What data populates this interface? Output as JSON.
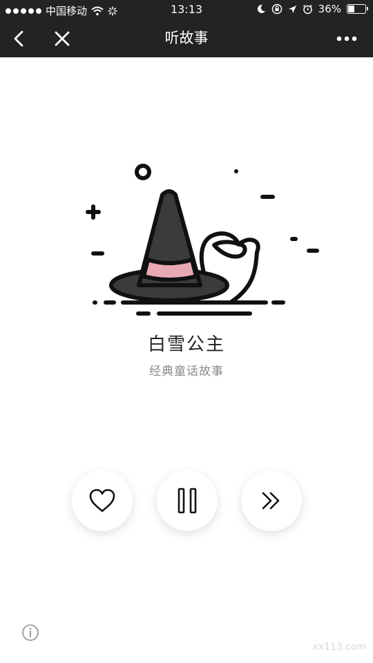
{
  "status_bar": {
    "carrier": "中国移动",
    "time": "13:13",
    "battery": "36%",
    "battery_level": 0.36,
    "icons": [
      "signal-dots",
      "wifi-icon",
      "loading-icon",
      "moon-icon",
      "orientation-lock-icon",
      "location-arrow-icon",
      "alarm-icon",
      "battery-icon"
    ]
  },
  "nav": {
    "title": "听故事",
    "back_icon": "chevron-left-icon",
    "close_icon": "close-icon",
    "more_icon": "more-dots-icon"
  },
  "story": {
    "title": "白雪公主",
    "subtitle": "经典童话故事",
    "illustration": "witch-hat-and-apple",
    "hat_band_color": "#e8a8b4"
  },
  "controls": {
    "like_icon": "heart-icon",
    "pause_icon": "pause-icon",
    "next_icon": "double-chevron-right-icon"
  },
  "footer": {
    "info_icon": "info-icon",
    "watermark": "xx113.com"
  }
}
